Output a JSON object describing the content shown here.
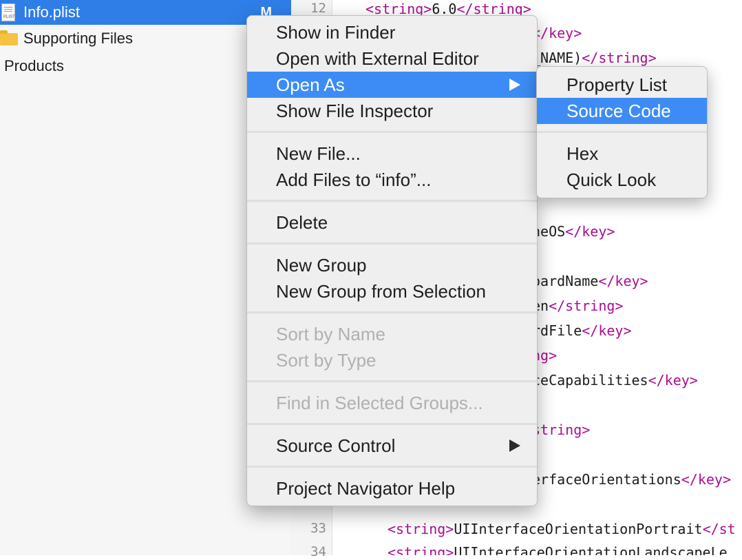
{
  "navigator": {
    "items": [
      {
        "label": "Info.plist",
        "badge": "M",
        "icon": "plist-file-icon",
        "icon_text": "PLIST",
        "selected": true
      },
      {
        "label": "Supporting Files",
        "icon": "folder-icon"
      },
      {
        "label": "Products"
      }
    ]
  },
  "editor": {
    "line_numbers": [
      "12",
      "33",
      "34"
    ],
    "lines": [
      {
        "parts": [
          {
            "t": "<string>",
            "k": "tag"
          },
          {
            "t": "6.0",
            "k": "txt"
          },
          {
            "t": "</string>",
            "k": "tag"
          }
        ]
      },
      {
        "parts": [
          {
            "t": "</key>",
            "k": "tag"
          }
        ]
      },
      {
        "parts": [
          {
            "t": "_NAME)",
            "k": "txt"
          },
          {
            "t": "</string>",
            "k": "tag"
          }
        ]
      },
      {
        "parts": [
          {
            "t": "neOS",
            "k": "txt"
          },
          {
            "t": "</key>",
            "k": "tag"
          }
        ]
      },
      {
        "parts": [
          {
            "t": "oardName",
            "k": "txt"
          },
          {
            "t": "</key>",
            "k": "tag"
          }
        ]
      },
      {
        "parts": [
          {
            "t": "en",
            "k": "txt"
          },
          {
            "t": "</string>",
            "k": "tag"
          }
        ]
      },
      {
        "parts": [
          {
            "t": "rdFile",
            "k": "txt"
          },
          {
            "t": "</key>",
            "k": "tag"
          }
        ]
      },
      {
        "parts": [
          {
            "t": "ng>",
            "k": "tag"
          }
        ]
      },
      {
        "parts": [
          {
            "t": "ceCapabilities",
            "k": "txt"
          },
          {
            "t": "</key>",
            "k": "tag"
          }
        ]
      },
      {
        "parts": [
          {
            "t": "string>",
            "k": "tag"
          }
        ]
      },
      {
        "parts": [
          {
            "t": "erfaceOrientations",
            "k": "txt"
          },
          {
            "t": "</key>",
            "k": "tag"
          }
        ]
      },
      {
        "parts": [
          {
            "t": "<string>",
            "k": "tag"
          },
          {
            "t": "UIInterfaceOrientationPortrait",
            "k": "txt"
          },
          {
            "t": "</st",
            "k": "tag"
          }
        ]
      },
      {
        "parts": [
          {
            "t": "<string>",
            "k": "tag"
          },
          {
            "t": "UIInterfaceOrientationLandscapeLe",
            "k": "txt"
          }
        ]
      }
    ]
  },
  "context_menu": {
    "items": [
      {
        "label": "Show in Finder"
      },
      {
        "label": "Open with External Editor"
      },
      {
        "label": "Open As",
        "submenu": true,
        "highlighted": true
      },
      {
        "label": "Show File Inspector"
      },
      {
        "separator": true
      },
      {
        "label": "New File..."
      },
      {
        "label": "Add Files to “info”..."
      },
      {
        "separator": true
      },
      {
        "label": "Delete"
      },
      {
        "separator": true
      },
      {
        "label": "New Group"
      },
      {
        "label": "New Group from Selection"
      },
      {
        "separator": true
      },
      {
        "label": "Sort by Name",
        "disabled": true
      },
      {
        "label": "Sort by Type",
        "disabled": true
      },
      {
        "separator": true
      },
      {
        "label": "Find in Selected Groups...",
        "disabled": true
      },
      {
        "separator": true
      },
      {
        "label": "Source Control",
        "submenu": true
      },
      {
        "separator": true
      },
      {
        "label": "Project Navigator Help"
      }
    ]
  },
  "submenu": {
    "items": [
      {
        "label": "Property List"
      },
      {
        "label": "Source Code",
        "highlighted": true
      },
      {
        "separator": true
      },
      {
        "label": "Hex"
      },
      {
        "label": "Quick Look"
      }
    ]
  },
  "colors": {
    "selection": "#2f7ee8",
    "menu_highlight": "#3d8cf5",
    "xml_tag": "#aa0d91"
  }
}
